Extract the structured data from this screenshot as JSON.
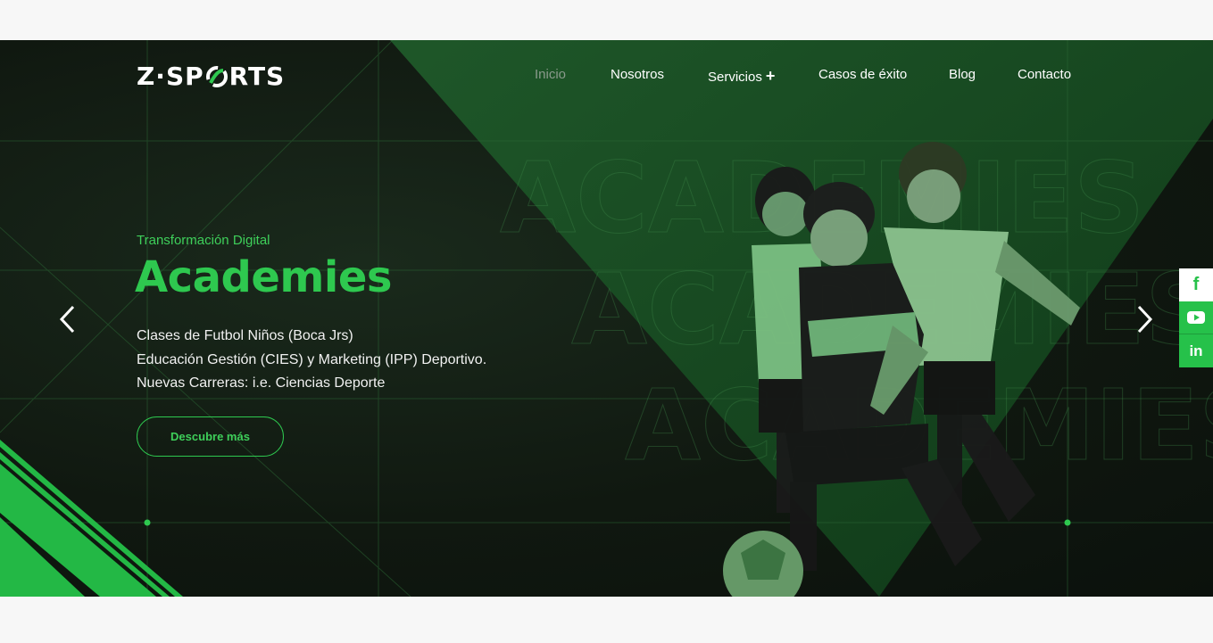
{
  "brand": {
    "logo_text_left": "Z·SP",
    "logo_text_right": "RTS",
    "logo_icon": "swirl-o-icon",
    "accent": "#2ec84f"
  },
  "nav": {
    "items": [
      {
        "label": "Inicio",
        "active": true
      },
      {
        "label": "Nosotros"
      },
      {
        "label": "Servicios",
        "has_submenu": true,
        "submenu_icon": "+"
      },
      {
        "label": "Casos de éxito"
      },
      {
        "label": "Blog"
      },
      {
        "label": "Contacto"
      }
    ]
  },
  "hero": {
    "tagline": "Transformación Digital",
    "title": "Academies",
    "lines": [
      "Clases de Futbol Niños (Boca Jrs)",
      "Educación Gestión (CIES) y Marketing (IPP) Deportivo.",
      "Nuevas Carreras: i.e. Ciencias Deporte"
    ],
    "cta_label": "Descubre más",
    "bg_watermark": "ACADEMIES",
    "prev_icon": "chevron-left-icon",
    "next_icon": "chevron-right-icon"
  },
  "social": [
    {
      "name": "facebook",
      "icon": "facebook-icon",
      "glyph": "f"
    },
    {
      "name": "youtube",
      "icon": "youtube-icon"
    },
    {
      "name": "linkedin",
      "icon": "linkedin-icon",
      "glyph": "in"
    }
  ]
}
